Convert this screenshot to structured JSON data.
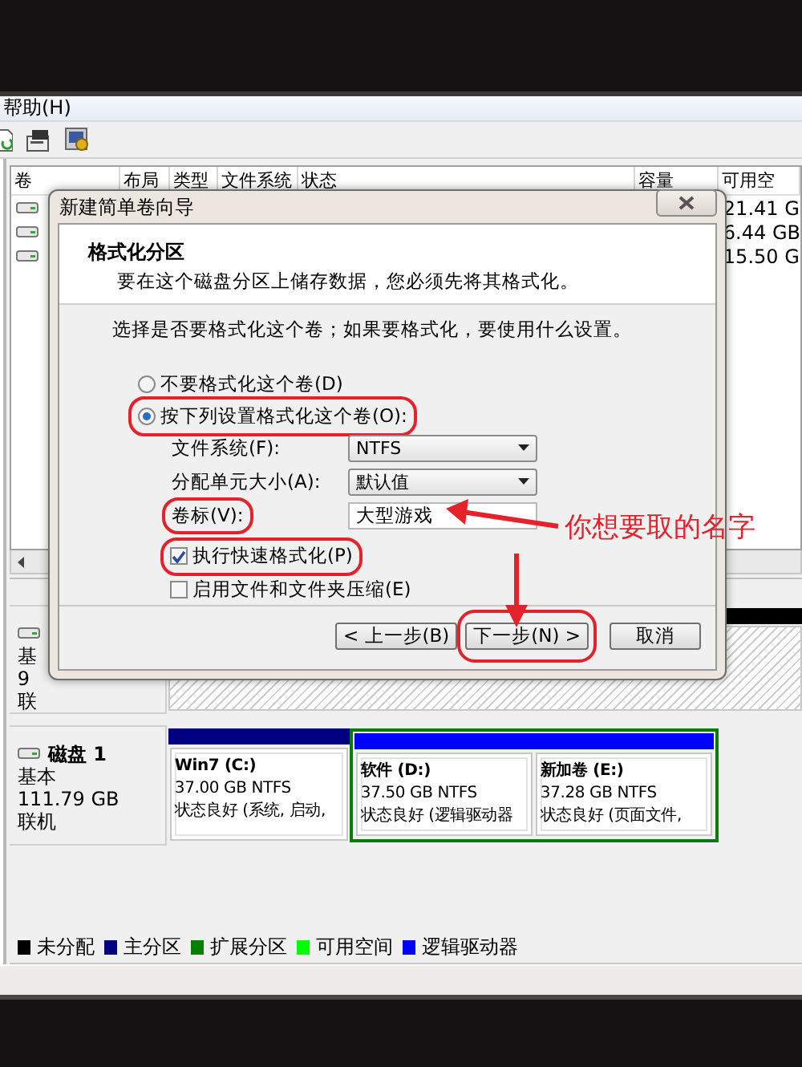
{
  "menu": [
    {
      "label": "帮助(H)"
    }
  ],
  "volume_list": {
    "columns": [
      "卷",
      "布局",
      "类型",
      "文件系统",
      "状态",
      "容量",
      "可用空"
    ],
    "rows": [
      {
        "free": "21.41 G"
      },
      {
        "free": "6.44 GB"
      },
      {
        "free": "15.50 G"
      }
    ]
  },
  "dialog": {
    "title": "新建简单卷向导",
    "heading": "格式化分区",
    "subheading": "要在这个磁盘分区上储存数据，您必须先将其格式化。",
    "prompt": "选择是否要格式化这个卷；如果要格式化，要使用什么设置。",
    "options": [
      {
        "label": "不要格式化这个卷(D)",
        "selected": false,
        "highlighted": false
      },
      {
        "label": "按下列设置格式化这个卷(O):",
        "selected": true,
        "highlighted": true
      }
    ],
    "fields": [
      {
        "kind": "dropdown",
        "label": "文件系统(F):",
        "value": "NTFS",
        "highlighted": false
      },
      {
        "kind": "dropdown",
        "label": "分配单元大小(A):",
        "value": "默认值",
        "highlighted": false
      },
      {
        "kind": "text",
        "label": "卷标(V):",
        "value": "大型游戏",
        "highlighted": true
      }
    ],
    "checkboxes": [
      {
        "label": "执行快速格式化(P)",
        "checked": true,
        "highlighted": true
      },
      {
        "label": "启用文件和文件夹压缩(E)",
        "checked": false,
        "highlighted": false
      }
    ],
    "buttons": [
      {
        "label": "< 上一步(B)",
        "highlighted": false
      },
      {
        "label": "下一步(N) >",
        "highlighted": true
      },
      {
        "label": "取消",
        "highlighted": false
      }
    ]
  },
  "disks": [
    {
      "lines": [
        "基",
        "9",
        "联"
      ],
      "partitions": [
        {
          "kind": "unallocated"
        }
      ]
    },
    {
      "name": "磁盘 1",
      "lines": [
        "基本",
        "111.79 GB",
        "联机"
      ],
      "partitions": [
        {
          "kind": "primary",
          "name": "Win7  (C:)",
          "size": "37.00 GB NTFS",
          "status": "状态良好 (系统, 启动,"
        },
        {
          "kind": "extended",
          "children": [
            {
              "kind": "logical",
              "name": "软件  (D:)",
              "size": "37.50 GB NTFS",
              "status": "状态良好 (逻辑驱动器"
            },
            {
              "kind": "logical",
              "name": "新加卷  (E:)",
              "size": "37.28 GB NTFS",
              "status": "状态良好 (页面文件,"
            }
          ]
        }
      ]
    }
  ],
  "legend": [
    {
      "label": "未分配",
      "color": "#000000"
    },
    {
      "label": "主分区",
      "color": "#000080"
    },
    {
      "label": "扩展分区",
      "color": "#008000"
    },
    {
      "label": "可用空间",
      "color": "#00ff00"
    },
    {
      "label": "逻辑驱动器",
      "color": "#0000ff"
    }
  ],
  "annotation": {
    "text": "你想要取的名字"
  }
}
